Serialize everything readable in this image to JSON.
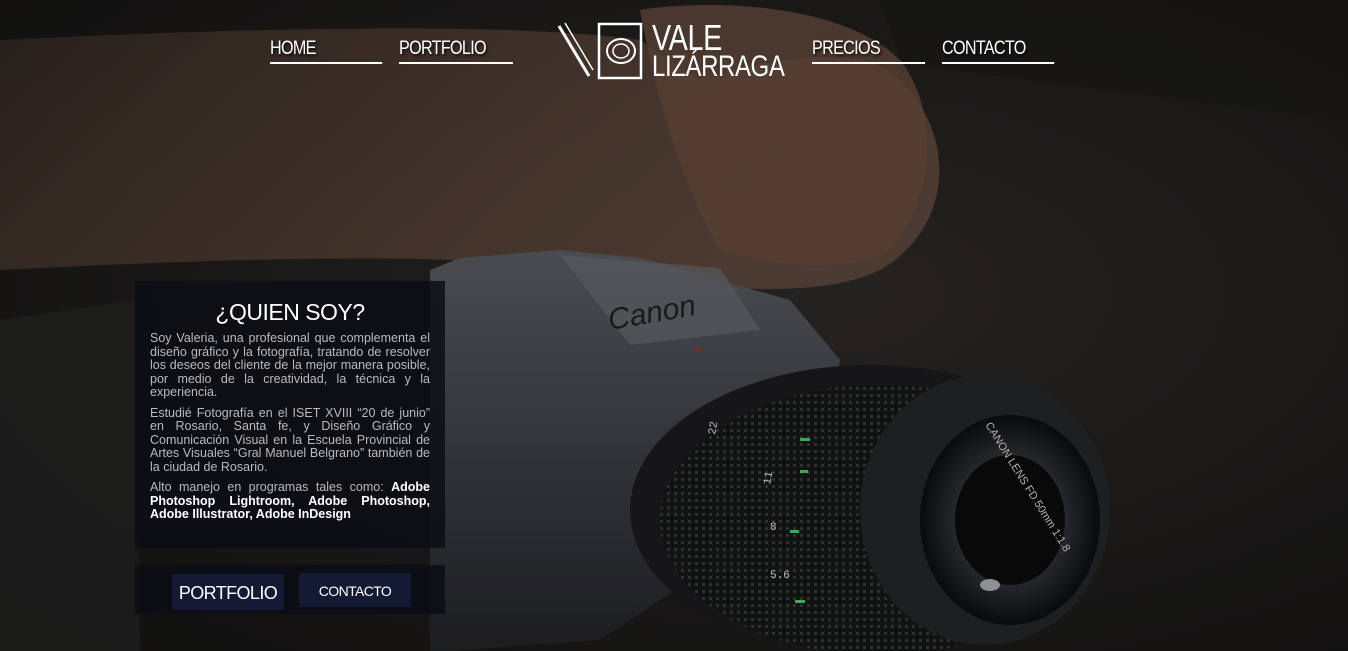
{
  "nav": {
    "home": "HOME",
    "portfolio": "PORTFOLIO",
    "precios": "PRECIOS",
    "contacto": "CONTACTO"
  },
  "logo": {
    "line1": "VALE",
    "line2": "LIZÁRRAGA",
    "icon": "pencil-camera-icon"
  },
  "camera_texts": {
    "brand": "Canon",
    "lens": "CANON LENS FD 50mm 1:1.8"
  },
  "about": {
    "title": "¿QUIEN SOY?",
    "p1": "Soy Valeria, una profesional que complementa el diseño gráfico y la fotografía, tratando de resolver los deseos del cliente de la mejor manera posible, por medio de la creatividad, la técnica y la experiencia.",
    "p2": "Estudié Fotografía en el ISET XVIII “20 de junio” en Rosario, Santa fe, y Diseño Gráfico y Comunicación Visual en la Escuela Provincial de Artes Visuales “Gral Manuel Belgrano” también de la ciudad de Rosario.",
    "p3_prefix": "Alto manejo en programas tales como: ",
    "p3_bold": "Adobe Photoshop Lightroom, Adobe Photoshop, Adobe Illustrator, Adobe InDesign"
  },
  "buttons": {
    "portfolio": "PORTFOLIO",
    "contacto": "CONTACTO"
  },
  "colors": {
    "button_bg": "#141a34",
    "panel_bg": "#0c0d16",
    "text_light": "#ffffff",
    "text_muted": "#b9b9bf"
  }
}
